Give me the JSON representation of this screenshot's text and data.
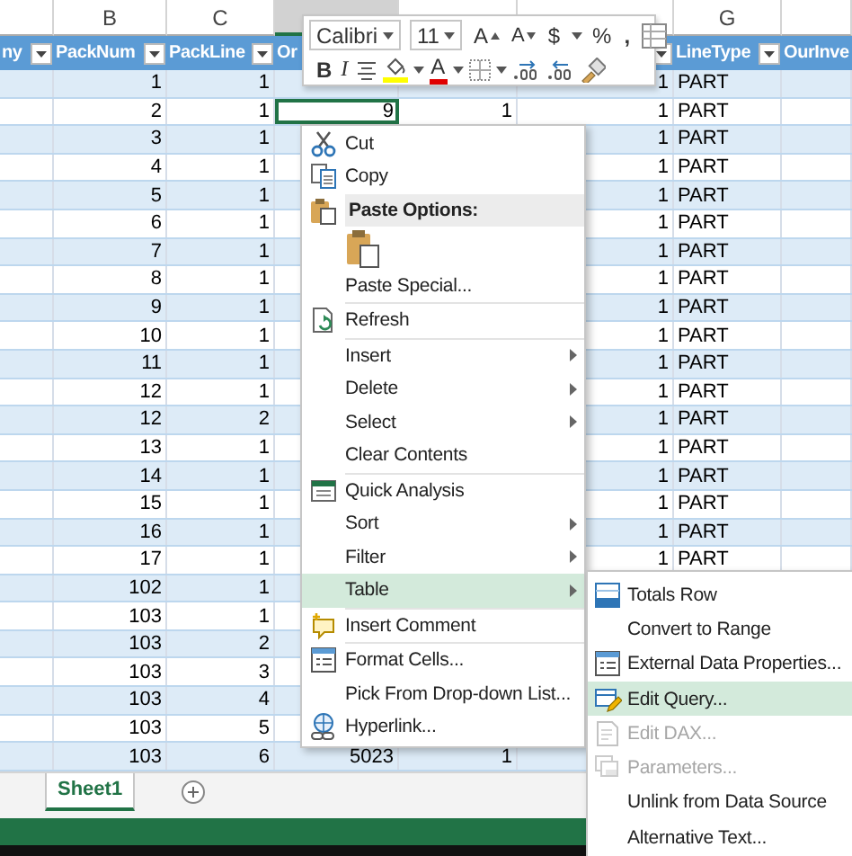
{
  "columns": [
    {
      "name": "ny",
      "filter_button": true,
      "selected": false
    },
    {
      "letter": "B",
      "name": "PackNum",
      "filter_button": true,
      "selected": false
    },
    {
      "letter": "C",
      "name": "PackLine",
      "filter_button": true,
      "selected": false
    },
    {
      "name": "Or",
      "selected": true
    },
    {},
    {
      "filter_button": true
    },
    {
      "letter": "G",
      "name": "LineType",
      "filter_button": true,
      "selected": false
    },
    {
      "name": "OurInve",
      "selected": false
    }
  ],
  "rows": [
    {
      "packnum": "1",
      "packline": "1",
      "column_f": "1",
      "linetype": "PART",
      "column_d_active": false
    },
    {
      "packnum": "2",
      "packline": "1",
      "column_d": "9",
      "column_e": "1",
      "column_f": "1",
      "linetype": "PART",
      "column_d_active": true
    },
    {
      "packnum": "3",
      "packline": "1",
      "column_f": "1",
      "linetype": "PART",
      "column_d_active": false
    },
    {
      "packnum": "4",
      "packline": "1",
      "column_f": "1",
      "linetype": "PART",
      "column_d_active": false
    },
    {
      "packnum": "5",
      "packline": "1",
      "column_f": "1",
      "linetype": "PART",
      "column_d_active": false
    },
    {
      "packnum": "6",
      "packline": "1",
      "column_f": "1",
      "linetype": "PART",
      "column_d_active": false
    },
    {
      "packnum": "7",
      "packline": "1",
      "column_f": "1",
      "linetype": "PART",
      "column_d_active": false
    },
    {
      "packnum": "8",
      "packline": "1",
      "column_f": "1",
      "linetype": "PART",
      "column_d_active": false
    },
    {
      "packnum": "9",
      "packline": "1",
      "column_f": "1",
      "linetype": "PART",
      "column_d_active": false
    },
    {
      "packnum": "10",
      "packline": "1",
      "column_f": "1",
      "linetype": "PART",
      "column_d_active": false
    },
    {
      "packnum": "11",
      "packline": "1",
      "column_f": "1",
      "linetype": "PART",
      "column_d_active": false
    },
    {
      "packnum": "12",
      "packline": "1",
      "column_f": "1",
      "linetype": "PART",
      "column_d_active": false
    },
    {
      "packnum": "12",
      "packline": "2",
      "column_f": "1",
      "linetype": "PART",
      "column_d_active": false
    },
    {
      "packnum": "13",
      "packline": "1",
      "column_f": "1",
      "linetype": "PART",
      "column_d_active": false
    },
    {
      "packnum": "14",
      "packline": "1",
      "column_f": "1",
      "linetype": "PART",
      "column_d_active": false
    },
    {
      "packnum": "15",
      "packline": "1",
      "column_f": "1",
      "linetype": "PART",
      "column_d_active": false
    },
    {
      "packnum": "16",
      "packline": "1",
      "column_f": "1",
      "linetype": "PART",
      "column_d_active": false
    },
    {
      "packnum": "17",
      "packline": "1",
      "column_f": "1",
      "linetype": "PART",
      "column_d_active": false
    },
    {
      "packnum": "102",
      "packline": "1",
      "column_d_active": false
    },
    {
      "packnum": "103",
      "packline": "1",
      "column_d_active": false
    },
    {
      "packnum": "103",
      "packline": "2",
      "column_d_active": false
    },
    {
      "packnum": "103",
      "packline": "3",
      "column_d_active": false
    },
    {
      "packnum": "103",
      "packline": "4",
      "column_d_active": false
    },
    {
      "packnum": "103",
      "packline": "5",
      "column_d_active": false
    },
    {
      "packnum": "103",
      "packline": "6",
      "column_d": "5023",
      "column_e": "1",
      "column_d_active": false
    }
  ],
  "mini_toolbar": {
    "font": {
      "value": "Calibri"
    },
    "size": {
      "value": "11"
    },
    "rows": [
      [
        {
          "kind": "grow",
          "label": "A"
        },
        {
          "kind": "shrink",
          "label": "A"
        },
        {
          "kind": "currency",
          "label": "$",
          "dropdown": true
        },
        {
          "kind": "percent",
          "label": "%"
        },
        {
          "kind": "comma",
          "label": ","
        },
        {
          "kind": "table_style"
        }
      ],
      [
        {
          "kind": "bold",
          "label": "B"
        },
        {
          "kind": "italic",
          "label": "I"
        },
        {
          "kind": "align"
        },
        {
          "kind": "fill",
          "dropdown": true
        },
        {
          "kind": "font_color",
          "label": "A",
          "dropdown": true
        },
        {
          "kind": "borders",
          "dropdown": true
        },
        {
          "kind": "inc_decimal"
        },
        {
          "kind": "dec_decimal"
        },
        {
          "kind": "painter"
        }
      ]
    ]
  },
  "context_menu": {
    "items": [
      {
        "kind": "command",
        "label": "Cut",
        "submenu": false,
        "highlighted": false,
        "disabled": false
      },
      {
        "kind": "command",
        "label": "Copy",
        "submenu": false,
        "highlighted": false,
        "disabled": false
      },
      {
        "kind": "header",
        "label": "Paste Options:"
      },
      {
        "kind": "paste_buttons"
      },
      {
        "kind": "command",
        "label": "Paste Special...",
        "submenu": false,
        "highlighted": false,
        "disabled": false
      },
      {
        "kind": "separator"
      },
      {
        "kind": "command",
        "label": "Refresh",
        "submenu": false,
        "highlighted": false,
        "disabled": false
      },
      {
        "kind": "separator"
      },
      {
        "kind": "command",
        "label": "Insert",
        "submenu": true,
        "highlighted": false,
        "disabled": false
      },
      {
        "kind": "command",
        "label": "Delete",
        "submenu": true,
        "highlighted": false,
        "disabled": false
      },
      {
        "kind": "command",
        "label": "Select",
        "submenu": true,
        "highlighted": false,
        "disabled": false
      },
      {
        "kind": "command",
        "label": "Clear Contents",
        "submenu": false,
        "highlighted": false,
        "disabled": false
      },
      {
        "kind": "separator"
      },
      {
        "kind": "command",
        "label": "Quick Analysis",
        "submenu": false,
        "highlighted": false,
        "disabled": false
      },
      {
        "kind": "command",
        "label": "Sort",
        "submenu": true,
        "highlighted": false,
        "disabled": false
      },
      {
        "kind": "command",
        "label": "Filter",
        "submenu": true,
        "highlighted": false,
        "disabled": false
      },
      {
        "kind": "command",
        "label": "Table",
        "submenu": true,
        "highlighted": true,
        "disabled": false
      },
      {
        "kind": "separator"
      },
      {
        "kind": "command",
        "label": "Insert Comment",
        "submenu": false,
        "highlighted": false,
        "disabled": false
      },
      {
        "kind": "separator"
      },
      {
        "kind": "command",
        "label": "Format Cells...",
        "submenu": false,
        "highlighted": false,
        "disabled": false
      },
      {
        "kind": "command",
        "label": "Pick From Drop-down List...",
        "submenu": false,
        "highlighted": false,
        "disabled": false
      },
      {
        "kind": "command",
        "label": "Hyperlink...",
        "submenu": false,
        "highlighted": false,
        "disabled": false
      }
    ]
  },
  "table_submenu": {
    "items": [
      {
        "kind": "command",
        "label": "Totals Row",
        "submenu": false,
        "highlighted": false,
        "disabled": false
      },
      {
        "kind": "command",
        "label": "Convert to Range",
        "submenu": false,
        "highlighted": false,
        "disabled": false
      },
      {
        "kind": "command",
        "label": "External Data Properties...",
        "submenu": false,
        "highlighted": false,
        "disabled": false
      },
      {
        "kind": "command",
        "label": "Edit Query...",
        "submenu": false,
        "highlighted": true,
        "disabled": false
      },
      {
        "kind": "command",
        "label": "Edit DAX...",
        "submenu": false,
        "highlighted": false,
        "disabled": true
      },
      {
        "kind": "command",
        "label": "Parameters...",
        "submenu": false,
        "highlighted": false,
        "disabled": true
      },
      {
        "kind": "command",
        "label": "Unlink from Data Source",
        "submenu": false,
        "highlighted": false,
        "disabled": false
      },
      {
        "kind": "command",
        "label": "Alternative Text...",
        "submenu": false,
        "highlighted": false,
        "disabled": false
      }
    ]
  },
  "sheet_tabs": [
    {
      "label": "Sheet1",
      "selected": true
    }
  ]
}
